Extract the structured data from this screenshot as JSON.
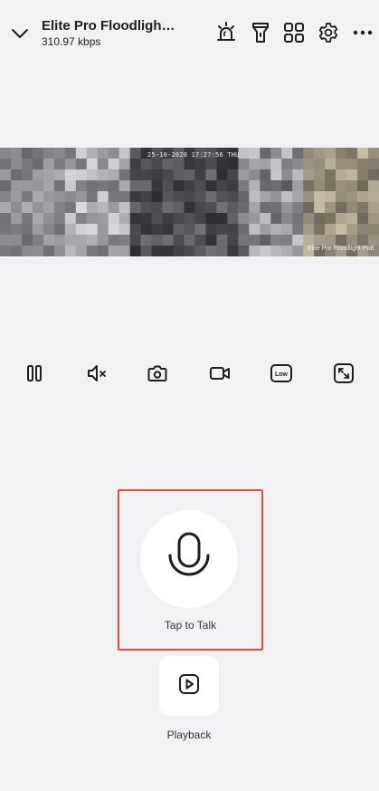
{
  "header": {
    "device_name": "Elite Pro Floodligh…",
    "bitrate": "310.97 kbps",
    "icons": [
      "chevron-down-icon",
      "siren-icon",
      "flashlight-icon",
      "grid-icon",
      "gear-icon",
      "more-icon"
    ]
  },
  "video": {
    "timestamp": "25-10-2020 17:27:56 THU",
    "watermark": "Elite Pro Floodlight PoE"
  },
  "controls": {
    "items": [
      "pause-icon",
      "mute-icon",
      "snapshot-icon",
      "record-icon",
      "quality-low-icon",
      "fullscreen-icon"
    ],
    "quality_label": "Low"
  },
  "talk": {
    "label": "Tap to Talk",
    "highlight_color": "#e34c3f"
  },
  "playback": {
    "label": "Playback"
  }
}
